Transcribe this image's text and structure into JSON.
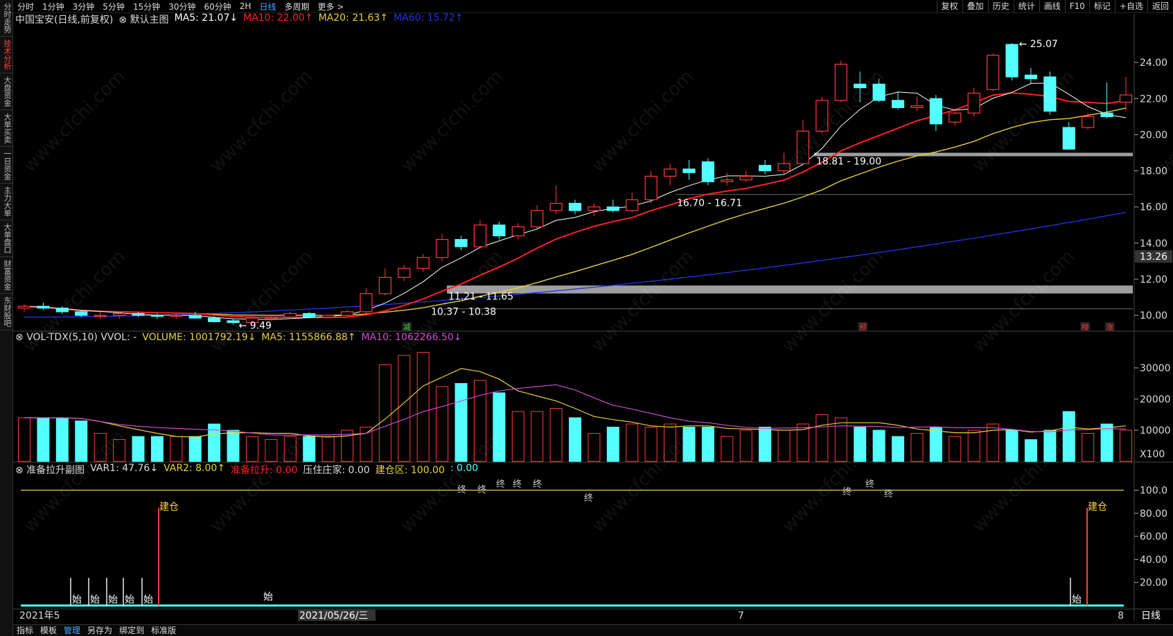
{
  "sidebar": [
    "分时走势",
    "技术分析",
    "大盘资金",
    "大单买卖",
    "一日资金",
    "主力大单",
    "大单盘口",
    "财富资金",
    "东财股吧"
  ],
  "sidebar_active": 1,
  "timeframes": [
    "分时",
    "1分钟",
    "3分钟",
    "5分钟",
    "15分钟",
    "30分钟",
    "60分钟",
    "2H",
    "日线",
    "多周期",
    "更多 >"
  ],
  "timeframe_active": 8,
  "right_tools": [
    "复权",
    "叠加",
    "历史",
    "统计",
    "画线",
    "F10",
    "标记",
    "+自选",
    "返回"
  ],
  "main_legend": {
    "title": "中国宝安(日线,前复权)",
    "indicator": "默认主图",
    "ma5": "MA5: 21.07↓",
    "ma10": "MA10: 22.00↑",
    "ma20": "MA20: 21.63↑",
    "ma60": "MA60: 15.72↑"
  },
  "vol_legend": {
    "name": "VOL-TDX(5,10) VVOL: -",
    "volume": "VOLUME: 1001792.19↓",
    "ma5": "MA5: 1155866.88↑",
    "ma10": "MA10: 1062266.50↓"
  },
  "sub_legend": {
    "name": "准备拉升副图",
    "var1": "VAR1: 47.76↓",
    "var2": "VAR2: 8.00↑",
    "prep": "准备拉升: 0.00",
    "press": "压住庄家: 0.00",
    "build": "建仓区: 100.00",
    "zero": ": 0.00"
  },
  "price_axis": [
    "24.00",
    "22.00",
    "20.00",
    "18.00",
    "16.00",
    "14.00",
    "12.00",
    "10.00"
  ],
  "current_price_tag": "13.26",
  "vol_axis": [
    "30000",
    "20000",
    "10000",
    "X100"
  ],
  "sub_axis": [
    "100.0",
    "80.00",
    "60.00",
    "40.00",
    "20.00"
  ],
  "annotations": {
    "high": "25.07",
    "low": "9.49",
    "zone1": "18.81 - 19.00",
    "zone2": "16.70 - 16.71",
    "zone3": "11.21 - 11.65",
    "zone4": "10.37 - 10.38",
    "jian_cang": "建仓",
    "shi": "始",
    "zhong": "终",
    "jian": "减",
    "yu": "预",
    "bang": "榜",
    "zhang": "涨"
  },
  "date_axis": [
    "2021年5",
    "2021/05/26/三",
    "7",
    "8"
  ],
  "period_label": "日线",
  "bottom_tabs": [
    "指标",
    "模板",
    "管理",
    "另存为",
    "绑定到",
    "标准版"
  ],
  "bottom_active": 2,
  "watermark": "www.cfchi.com",
  "colors": {
    "up": "#ff3b3b",
    "down": "#54ffff",
    "ma5": "#ffffff",
    "ma10": "#ff2020",
    "ma20": "#e6d23c",
    "ma60": "#2233dd",
    "vma10": "#d24bd2"
  },
  "chart_data": {
    "type": "candlestick",
    "candles": [
      [
        10.4,
        10.6,
        10.2,
        10.5
      ],
      [
        10.5,
        10.7,
        10.3,
        10.4
      ],
      [
        10.4,
        10.5,
        10.1,
        10.2
      ],
      [
        10.2,
        10.3,
        9.9,
        10.0
      ],
      [
        10.0,
        10.2,
        9.8,
        10.0
      ],
      [
        10.0,
        10.2,
        9.8,
        10.1
      ],
      [
        10.1,
        10.2,
        9.9,
        10.0
      ],
      [
        10.0,
        10.1,
        9.8,
        9.95
      ],
      [
        9.95,
        10.1,
        9.8,
        10.0
      ],
      [
        10.0,
        10.2,
        9.8,
        9.85
      ],
      [
        9.85,
        9.95,
        9.6,
        9.65
      ],
      [
        9.7,
        9.8,
        9.49,
        9.6
      ],
      [
        9.6,
        9.9,
        9.55,
        9.85
      ],
      [
        9.85,
        10.0,
        9.75,
        9.9
      ],
      [
        9.9,
        10.2,
        9.8,
        10.1
      ],
      [
        10.1,
        10.2,
        9.85,
        9.9
      ],
      [
        9.9,
        10.05,
        9.85,
        10.0
      ],
      [
        10.0,
        10.3,
        9.9,
        10.2
      ],
      [
        10.2,
        11.5,
        10.1,
        11.2
      ],
      [
        11.2,
        12.6,
        11.1,
        12.1
      ],
      [
        12.1,
        12.8,
        11.9,
        12.6
      ],
      [
        12.6,
        13.4,
        12.4,
        13.2
      ],
      [
        13.2,
        14.5,
        13.0,
        14.2
      ],
      [
        14.2,
        14.4,
        13.6,
        13.8
      ],
      [
        13.8,
        15.3,
        13.7,
        15.0
      ],
      [
        15.0,
        15.2,
        14.2,
        14.4
      ],
      [
        14.4,
        15.1,
        14.2,
        14.9
      ],
      [
        14.9,
        16.1,
        14.8,
        15.8
      ],
      [
        15.8,
        17.2,
        15.6,
        16.2
      ],
      [
        16.2,
        16.4,
        15.6,
        15.8
      ],
      [
        15.8,
        16.2,
        15.5,
        16.0
      ],
      [
        16.0,
        16.4,
        15.7,
        15.8
      ],
      [
        15.8,
        16.8,
        15.7,
        16.4
      ],
      [
        16.4,
        18.0,
        16.2,
        17.7
      ],
      [
        17.7,
        18.4,
        17.2,
        18.1
      ],
      [
        18.1,
        18.6,
        17.5,
        17.9
      ],
      [
        18.5,
        18.7,
        17.2,
        17.4
      ],
      [
        17.4,
        17.9,
        17.2,
        17.5
      ],
      [
        17.5,
        18.0,
        17.4,
        17.7
      ],
      [
        18.3,
        18.6,
        17.8,
        18.0
      ],
      [
        18.0,
        19.0,
        17.8,
        18.4
      ],
      [
        18.4,
        20.8,
        18.3,
        20.2
      ],
      [
        20.2,
        22.1,
        20.1,
        21.9
      ],
      [
        21.9,
        24.1,
        21.8,
        23.9
      ],
      [
        22.8,
        23.5,
        21.8,
        22.6
      ],
      [
        22.8,
        23.1,
        21.8,
        21.9
      ],
      [
        21.9,
        22.4,
        21.4,
        21.5
      ],
      [
        21.5,
        22.1,
        21.3,
        21.6
      ],
      [
        22.0,
        22.2,
        20.2,
        20.6
      ],
      [
        20.7,
        21.3,
        20.5,
        21.2
      ],
      [
        21.2,
        22.6,
        21.0,
        22.3
      ],
      [
        22.5,
        24.5,
        22.4,
        24.4
      ],
      [
        25.0,
        25.07,
        23.0,
        23.2
      ],
      [
        23.3,
        23.7,
        22.8,
        23.1
      ],
      [
        23.2,
        23.5,
        21.1,
        21.3
      ],
      [
        20.4,
        20.7,
        19.2,
        19.2
      ],
      [
        20.4,
        21.2,
        20.3,
        21.0
      ],
      [
        21.2,
        22.9,
        20.9,
        21.0
      ],
      [
        21.8,
        23.2,
        21.3,
        22.2
      ]
    ],
    "volume": [
      14,
      14,
      14,
      13,
      9,
      7,
      8,
      8,
      8,
      8,
      12,
      10,
      8,
      7,
      8,
      8,
      8,
      10,
      11,
      31,
      34,
      35,
      24,
      25,
      26,
      22,
      16,
      16,
      17,
      14,
      9,
      11,
      12,
      11,
      12,
      11,
      11,
      8,
      10,
      11,
      10,
      12,
      15,
      14,
      11,
      10,
      8,
      9,
      11,
      8,
      10,
      12,
      10,
      7,
      10,
      16,
      9,
      12,
      10
    ],
    "ylim": [
      9.2,
      26.0
    ],
    "current_price": 13.26
  }
}
